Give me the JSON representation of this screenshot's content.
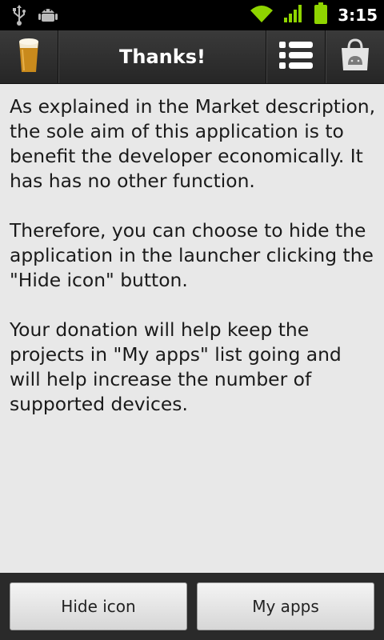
{
  "status_bar": {
    "time": "3:15",
    "icons": [
      "usb-icon",
      "android-debug-icon",
      "wifi-icon",
      "signal-icon",
      "battery-icon"
    ]
  },
  "action_bar": {
    "title": "Thanks!",
    "icons": [
      "beer-app-icon",
      "list-menu-icon",
      "market-bag-icon"
    ]
  },
  "content": {
    "paragraphs": [
      "As explained in the Market description, the sole aim of this application is to benefit the developer economically. It has has no other function.",
      "Therefore, you can choose to hide the application in the launcher clicking the \"Hide icon\" button.",
      "Your donation will help keep the projects in \"My apps\" list going and will help increase the number of supported devices."
    ]
  },
  "buttons": {
    "hide_icon": "Hide icon",
    "my_apps": "My apps"
  },
  "colors": {
    "background": "#e8e8e8",
    "action_bar": "#2e2e2e",
    "status_bar": "#000000",
    "status_accent": "#8fd400"
  }
}
